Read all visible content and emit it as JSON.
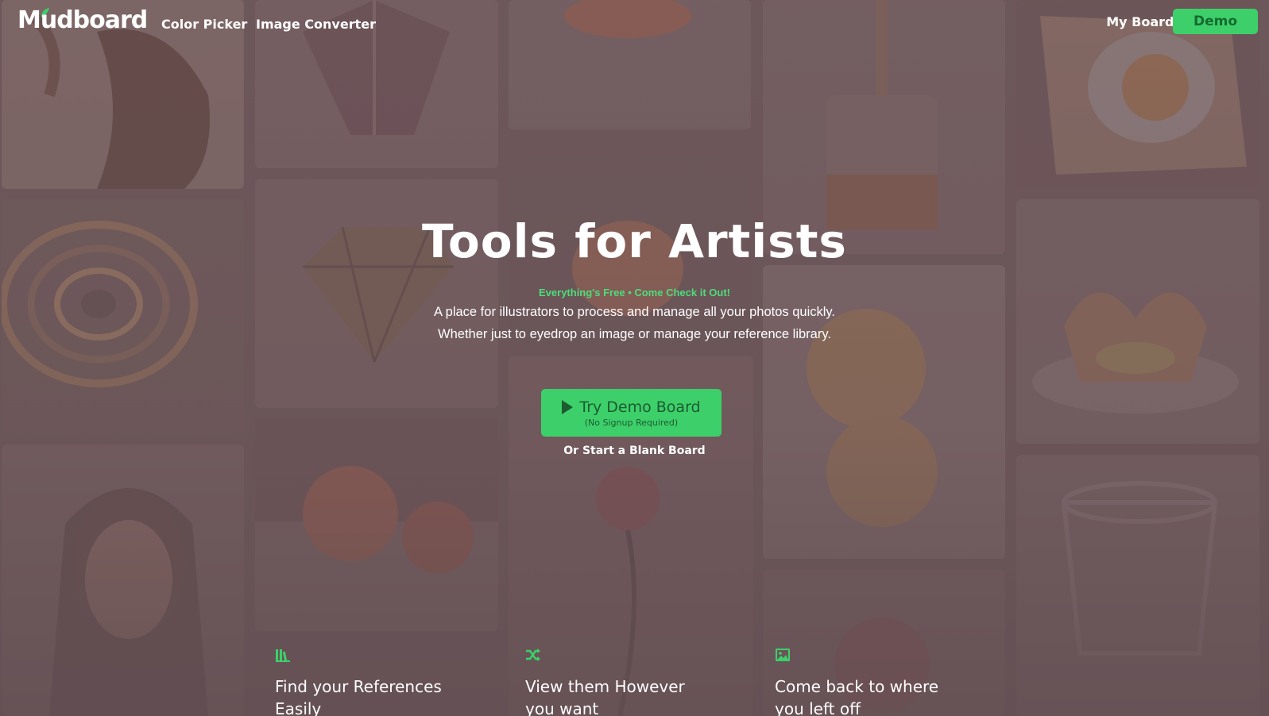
{
  "header": {
    "logo": "Mudboard",
    "nav": [
      "Color Picker",
      "Image Converter"
    ],
    "my_boards": "My Boards",
    "demo": "Demo"
  },
  "hero": {
    "title": "Tools for Artists",
    "tagline": "Everything's Free • Come Check it Out!",
    "subtitle_line1": "A place for illustrators to process and manage all your photos quickly.",
    "subtitle_line2": "Whether just to eyedrop an image or manage your reference library.",
    "cta_label": "Try Demo Board",
    "cta_sub": "(No Signup Required)",
    "blank_link": "Or Start a Blank Board"
  },
  "features": [
    {
      "icon": "library-icon",
      "title": "Find your References Easily"
    },
    {
      "icon": "shuffle-icon",
      "title": "View them However you want"
    },
    {
      "icon": "image-icon",
      "title": "Come back to where you left off"
    }
  ],
  "colors": {
    "accent": "#3dd06a",
    "accent_text": "#1c5a30",
    "tagline": "#4ddd7a",
    "background": "#6b5659"
  }
}
